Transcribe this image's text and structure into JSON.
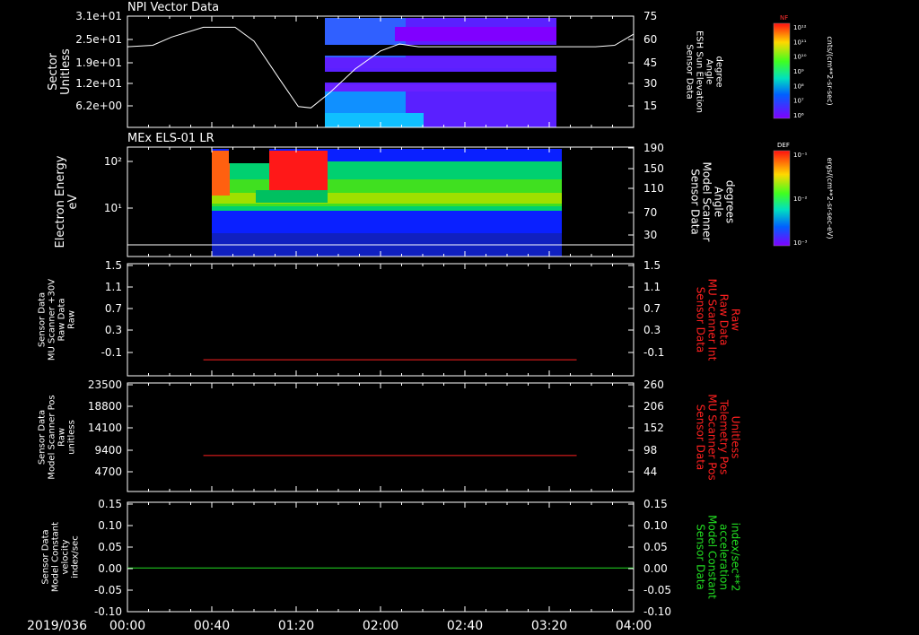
{
  "colors": {
    "background": "#000000",
    "axis": "#ffffff",
    "red_trace": "#ff2020",
    "green_trace": "#22dd22"
  },
  "time_axis": {
    "date_label": "2019/036",
    "ticks": [
      "00:00",
      "00:40",
      "01:20",
      "02:00",
      "02:40",
      "03:20",
      "04:00"
    ],
    "range_hours": [
      0,
      4
    ]
  },
  "panels": [
    {
      "id": "npi",
      "title": "NPI Vector Data",
      "left_label": [
        "Sector",
        "Unitless"
      ],
      "left_ticks": [
        "3.1e+01",
        "2.5e+01",
        "1.9e+01",
        "1.2e+01",
        "6.2e+00"
      ],
      "right_label": [
        "Sensor Data",
        "ESH Sun Elevation",
        "Angle",
        "degree"
      ],
      "right_ticks": [
        "75",
        "60",
        "45",
        "30",
        "15"
      ],
      "colorbar": {
        "title": "NF",
        "unit": "cnts/(cm**2-sr-sec)",
        "ticks": [
          "10¹²",
          "10¹¹",
          "10¹⁰",
          "10⁹",
          "10⁸",
          "10⁷",
          "10⁶"
        ]
      }
    },
    {
      "id": "els",
      "title": "MEx ELS-01 LR",
      "left_label": [
        "Electron Energy",
        "eV"
      ],
      "left_ticks": [
        "10²",
        "10¹"
      ],
      "right_label": [
        "Sensor Data",
        "Model Scanner",
        "Angle",
        "degrees"
      ],
      "right_ticks": [
        "190",
        "150",
        "110",
        "70",
        "30"
      ],
      "colorbar": {
        "title": "DEF",
        "unit": "ergs/(cm**2-sr-sec-eV)",
        "ticks": [
          "10⁻¹",
          "10⁻²",
          "10⁻³"
        ]
      }
    },
    {
      "id": "mu_int",
      "left_label": [
        "Sensor Data",
        "MU Scanner +30V",
        "Raw Data",
        "Raw"
      ],
      "left_ticks": [
        "1.5",
        "1.1",
        "0.7",
        "0.3",
        "-0.1"
      ],
      "right_label": [
        "Sensor Data",
        "MU Scanner Int",
        "Raw Data",
        "Raw"
      ],
      "right_ticks": [
        "1.5",
        "1.1",
        "0.7",
        "0.3",
        "-0.1"
      ]
    },
    {
      "id": "mu_pos",
      "left_label": [
        "Sensor Data",
        "Model Scanner Pos",
        "Raw",
        "unitless"
      ],
      "left_ticks": [
        "23500",
        "18800",
        "14100",
        "9400",
        "4700"
      ],
      "right_label": [
        "Sensor Data",
        "MU Scanner Pos",
        "Telemetry Pos",
        "Unitless"
      ],
      "right_ticks": [
        "260",
        "206",
        "152",
        "98",
        "44"
      ]
    },
    {
      "id": "model",
      "left_label": [
        "Sensor Data",
        "Model Constant",
        "velocity",
        "index/sec"
      ],
      "left_ticks": [
        "0.15",
        "0.10",
        "0.05",
        "0.00",
        "-0.05",
        "-0.10"
      ],
      "right_label": [
        "Sensor Data",
        "Model Constant",
        "acceleration",
        "index/sec**2"
      ],
      "right_ticks": [
        "0.15",
        "0.10",
        "0.05",
        "0.00",
        "-0.05",
        "-0.10"
      ]
    }
  ],
  "chart_data": [
    {
      "type": "line",
      "title": "NPI Vector Data",
      "ylabel": "Sensor Data ESH Sun Elevation Angle degree",
      "ylim": [
        0,
        80
      ],
      "x_hours": [
        0,
        0.2,
        0.35,
        0.6,
        0.85,
        1.0,
        1.2,
        1.35,
        1.45,
        1.6,
        1.8,
        2.0,
        2.15,
        2.3,
        2.6,
        3.0,
        3.4,
        3.7,
        3.85,
        4.0
      ],
      "values": [
        58,
        59,
        65,
        72,
        72,
        62,
        35,
        15,
        14,
        25,
        42,
        55,
        60,
        58,
        58,
        58,
        58,
        58,
        59,
        67
      ]
    },
    {
      "type": "heatmap",
      "title": "MEx ELS-01 LR",
      "ylabel": "Electron Energy eV",
      "data_span_hours": [
        0.68,
        3.37
      ],
      "scanner_angle_line": {
        "ylabel": "Sensor Data Model Scanner Angle degrees",
        "ylim": [
          0,
          190
        ],
        "value": 10
      }
    },
    {
      "type": "line",
      "series": [
        {
          "x_hours": [
            0.6,
            3.55
          ],
          "values": [
            0.0
          ]
        }
      ],
      "ylim": [
        -0.25,
        1.5
      ]
    },
    {
      "type": "line",
      "series": [
        {
          "x_hours": [
            0.6,
            3.55
          ],
          "values": [
            7800
          ]
        }
      ],
      "ylim": [
        0,
        23500
      ]
    },
    {
      "type": "line",
      "series": [
        {
          "x_hours": [
            0,
            4
          ],
          "values": [
            0.0
          ]
        }
      ],
      "ylim": [
        -0.1,
        0.15
      ]
    }
  ]
}
